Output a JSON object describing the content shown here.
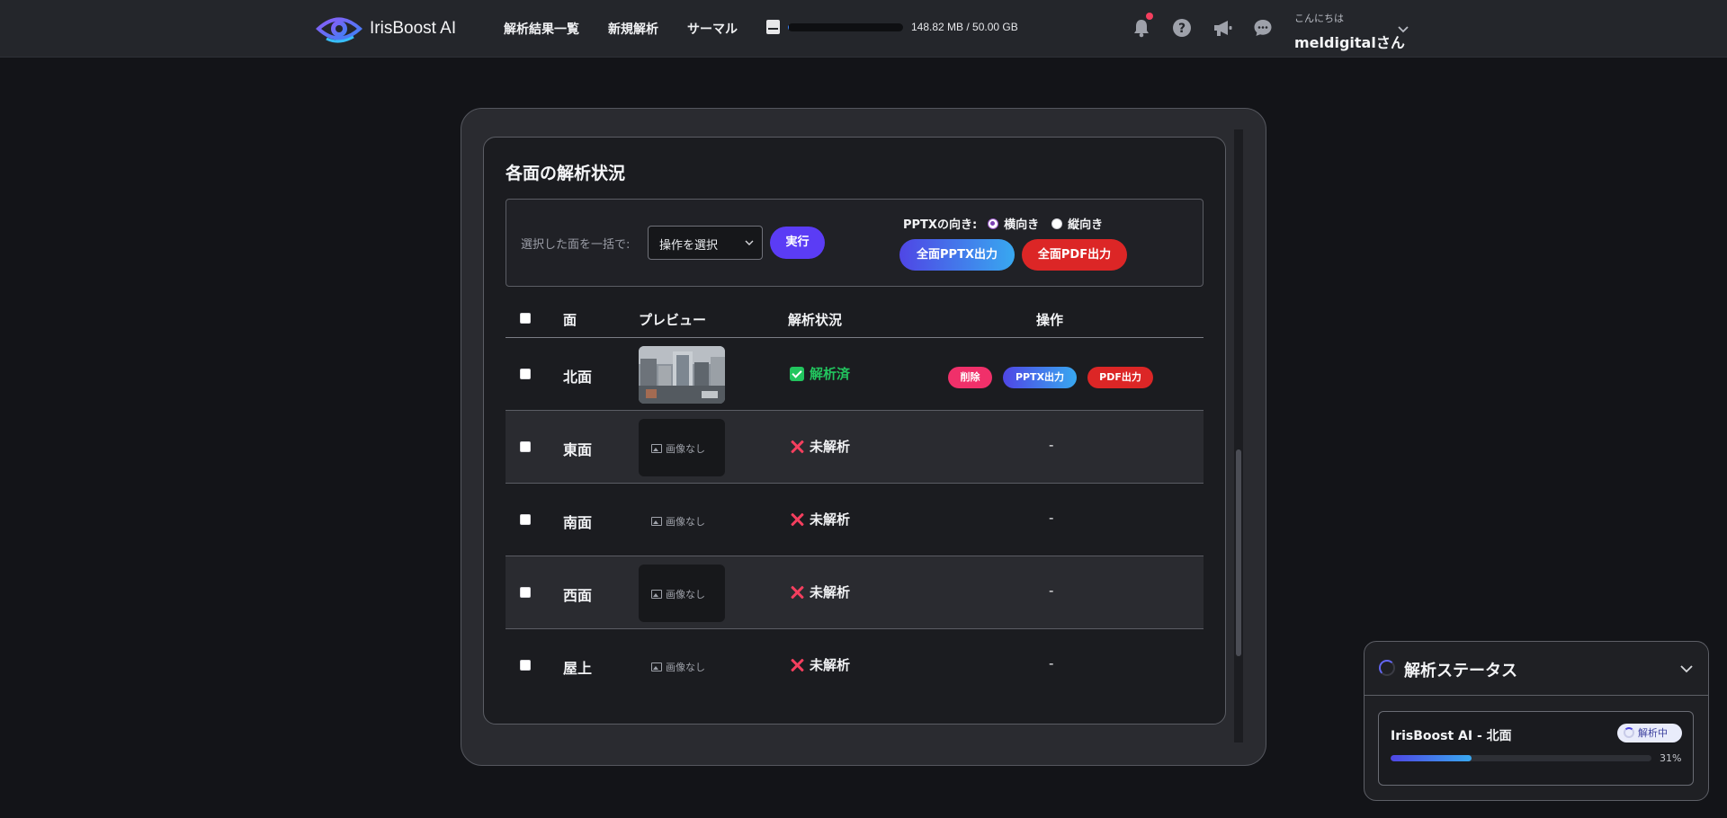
{
  "header": {
    "app_name": "IrisBoost AI",
    "nav": [
      "解析結果一覧",
      "新規解析",
      "サーマル"
    ],
    "storage": {
      "text": "148.82 MB / 50.00 GB",
      "used_fraction": 0.003
    },
    "icons": [
      "bell-icon",
      "help-icon",
      "megaphone-icon",
      "chat-icon"
    ],
    "greeting": "こんにちは",
    "user_name": "meldigitalさん"
  },
  "card": {
    "title": "各面の解析状況",
    "bulk_label": "選択した面を一括で:",
    "select_value": "操作を選択",
    "run_label": "実行",
    "orientation_label": "PPTXの向き:",
    "orientation_options": [
      "横向き",
      "縦向き"
    ],
    "orientation_selected": "横向き",
    "export_pptx_label": "全面PPTX出力",
    "export_pdf_label": "全面PDF出力"
  },
  "table": {
    "headers": [
      "面",
      "プレビュー",
      "解析状況",
      "操作"
    ],
    "rows": [
      {
        "face": "北面",
        "preview": "image",
        "status": "解析済",
        "status_type": "done",
        "actions": [
          "削除",
          "PPTX出力",
          "PDF出力"
        ]
      },
      {
        "face": "東面",
        "preview": "画像なし",
        "status": "未解析",
        "status_type": "none",
        "ops": "-"
      },
      {
        "face": "南面",
        "preview": "画像なし",
        "status": "未解析",
        "status_type": "none",
        "ops": "-"
      },
      {
        "face": "西面",
        "preview": "画像なし",
        "status": "未解析",
        "status_type": "none",
        "ops": "-"
      },
      {
        "face": "屋上",
        "preview": "画像なし",
        "status": "未解析",
        "status_type": "none",
        "ops": "-"
      }
    ]
  },
  "status_widget": {
    "title": "解析ステータス",
    "job": {
      "name": "IrisBoost AI - 北面",
      "badge": "解析中",
      "progress_text": "31%",
      "progress": 0.31
    }
  }
}
